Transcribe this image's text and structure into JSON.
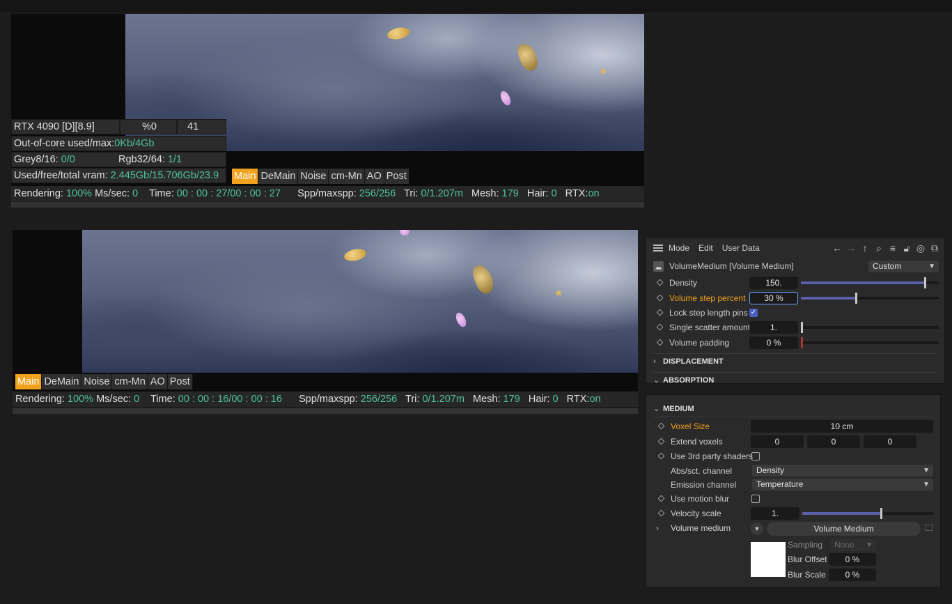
{
  "viewer1": {
    "gpu": {
      "name": "RTX 4090 [D][8.9]",
      "percent": "%0",
      "temp": "41"
    },
    "ooc": {
      "label": "Out-of-core used/max:",
      "value": "0Kb/4Gb"
    },
    "grey": {
      "label": "Grey8/16:",
      "value": "0/0"
    },
    "rgb": {
      "label": "Rgb32/64:",
      "value": "1/1"
    },
    "vram": {
      "label": "Used/free/total vram:",
      "value": "2.445Gb/15.706Gb/23.9"
    },
    "tabs": [
      "Main",
      "DeMain",
      "Noise",
      "cm-Mn",
      "AO",
      "Post"
    ],
    "status": {
      "rendering_label": "Rendering:",
      "rendering": "100%",
      "mssec_label": "Ms/sec:",
      "mssec": "0",
      "time_label": "Time:",
      "time": "00 : 00 : 27/00 : 00 : 27",
      "spp_label": "Spp/maxspp:",
      "spp": "256/256",
      "tri_label": "Tri:",
      "tri": "0/1.207m",
      "mesh_label": "Mesh:",
      "mesh": "179",
      "hair_label": "Hair:",
      "hair": "0",
      "rtx_label": "RTX:",
      "rtx": "on"
    }
  },
  "viewer2": {
    "tabs": [
      "Main",
      "DeMain",
      "Noise",
      "cm-Mn",
      "AO",
      "Post"
    ],
    "status": {
      "rendering_label": "Rendering:",
      "rendering": "100%",
      "mssec_label": "Ms/sec:",
      "mssec": "0",
      "time_label": "Time:",
      "time": "00 : 00 : 16/00 : 00 : 16",
      "spp_label": "Spp/maxspp:",
      "spp": "256/256",
      "tri_label": "Tri:",
      "tri": "0/1.207m",
      "mesh_label": "Mesh:",
      "mesh": "179",
      "hair_label": "Hair:",
      "hair": "0",
      "rtx_label": "RTX:",
      "rtx": "on"
    }
  },
  "attr": {
    "menu": [
      "Mode",
      "Edit",
      "User Data"
    ],
    "toolbar_icons": [
      "arrow-left-icon",
      "arrow-right-icon",
      "arrow-up-icon",
      "search-icon",
      "filter-icon",
      "lock-icon",
      "target-icon",
      "new-window-icon"
    ],
    "object_title": "VolumeMedium [Volume Medium]",
    "preset": "Custom",
    "params": {
      "density": {
        "label": "Density",
        "value": "150.",
        "level": 0.9
      },
      "step": {
        "label": "Volume step percent",
        "value": "30 %",
        "level": 0.4
      },
      "lock": {
        "label": "Lock step length pins",
        "checked": true
      },
      "scatter": {
        "label": "Single scatter amount",
        "value": "1.",
        "level": 0.0
      },
      "padding": {
        "label": "Volume padding",
        "value": "0 %",
        "level": 0.0
      }
    },
    "sections": {
      "displacement": "DISPLACEMENT",
      "absorption": "ABSORPTION"
    }
  },
  "medium": {
    "section": "MEDIUM",
    "voxel": {
      "label": "Voxel Size",
      "value": "10 cm"
    },
    "extend": {
      "label": "Extend voxels",
      "values": [
        "0",
        "0",
        "0"
      ]
    },
    "thirdparty": {
      "label": "Use 3rd party shaders",
      "checked": false
    },
    "abs_channel": {
      "label": "Abs/sct. channel",
      "value": "Density"
    },
    "emission_channel": {
      "label": "Emission channel",
      "value": "Temperature"
    },
    "motionblur": {
      "label": "Use motion blur",
      "checked": false
    },
    "velocity": {
      "label": "Velocity scale",
      "value": "1.",
      "level": 0.6
    },
    "volmedium": {
      "label": "Volume medium",
      "button": "Volume Medium"
    },
    "sampling": {
      "label": "Sampling",
      "value": "None"
    },
    "bluroffset": {
      "label": "Blur Offset",
      "value": "0 %"
    },
    "blurscale": {
      "label": "Blur Scale",
      "value": "0 %"
    }
  },
  "colors": {
    "accent": "#f0a21c",
    "value_green": "#4fc1a0",
    "slider_fill": "#5b5fa8"
  }
}
